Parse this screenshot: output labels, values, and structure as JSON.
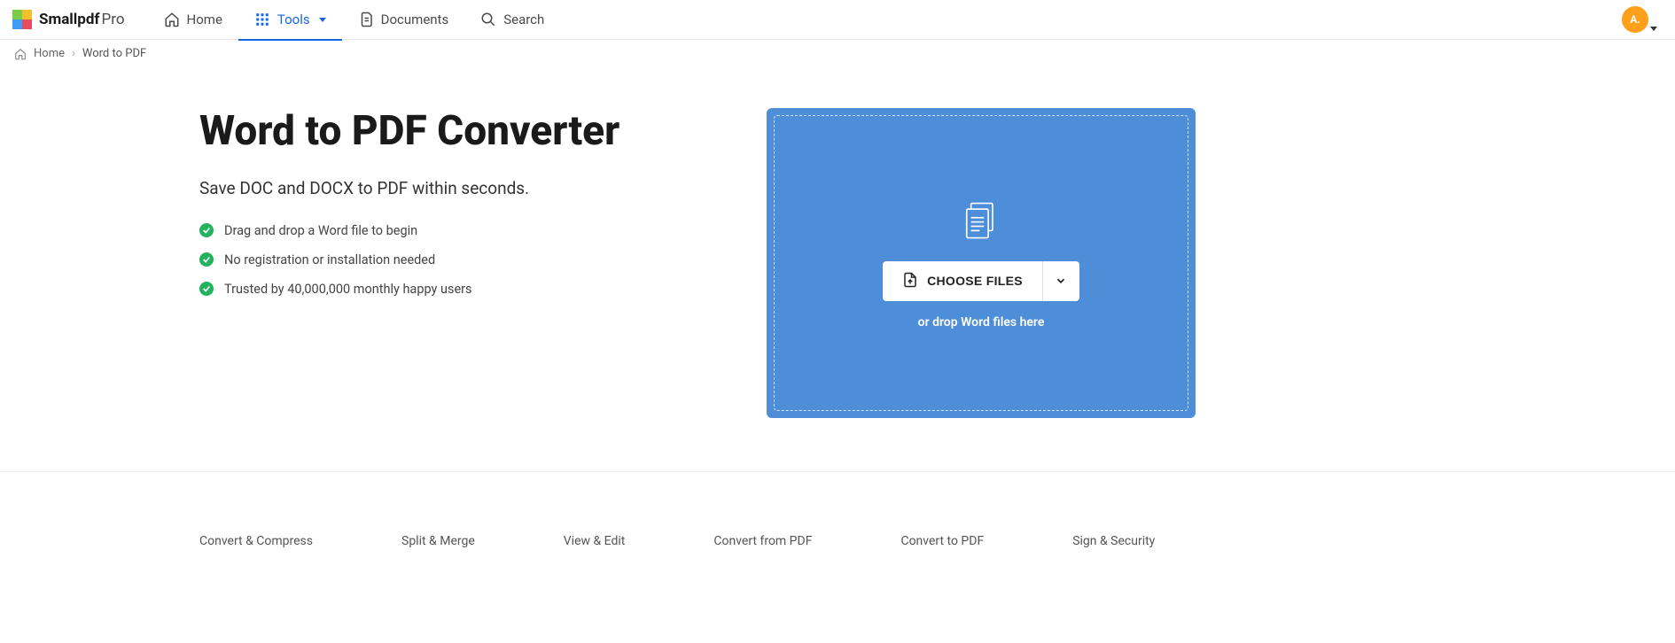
{
  "brand": {
    "name": "Smallpdf",
    "tier": "Pro"
  },
  "nav": {
    "home": "Home",
    "tools": "Tools",
    "documents": "Documents",
    "search": "Search"
  },
  "avatar": {
    "initials": "A."
  },
  "breadcrumb": {
    "home": "Home",
    "separator": "›",
    "current": "Word to PDF"
  },
  "hero": {
    "title": "Word to PDF Converter",
    "subtitle": "Save DOC and DOCX to PDF within seconds.",
    "features": [
      "Drag and drop a Word file to begin",
      "No registration or installation needed",
      "Trusted by 40,000,000 monthly happy users"
    ]
  },
  "dropzone": {
    "choose_label": "CHOOSE FILES",
    "hint": "or drop Word files here"
  },
  "categories": [
    "Convert & Compress",
    "Split & Merge",
    "View & Edit",
    "Convert from PDF",
    "Convert to PDF",
    "Sign & Security"
  ],
  "colors": {
    "primary_blue": "#1766e5",
    "dropzone_blue": "#4e8ed8",
    "check_green": "#22b35e",
    "avatar_orange": "#ff9f1a"
  }
}
